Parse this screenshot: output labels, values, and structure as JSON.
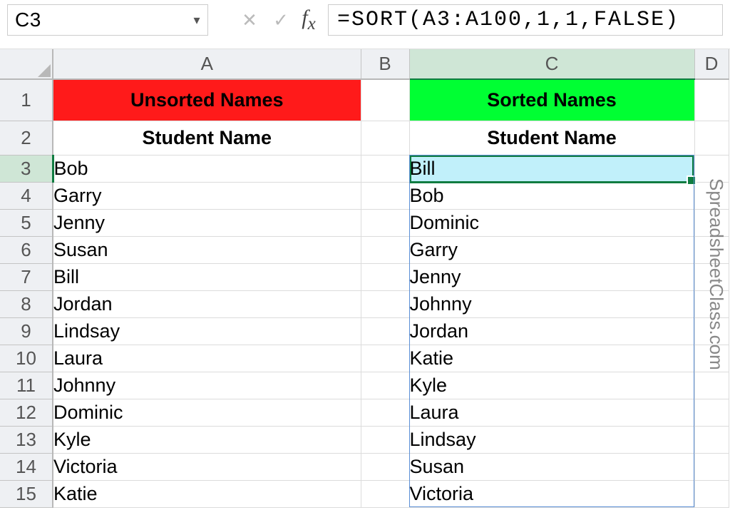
{
  "nameBox": "C3",
  "formula": "=SORT(A3:A100,1,1,FALSE)",
  "columns": [
    "A",
    "B",
    "C",
    "D"
  ],
  "rowNumbers": [
    "1",
    "2",
    "3",
    "4",
    "5",
    "6",
    "7",
    "8",
    "9",
    "10",
    "11",
    "12",
    "13",
    "14",
    "15"
  ],
  "headers": {
    "unsorted": "Unsorted Names",
    "sorted": "Sorted Names",
    "sub": "Student Name"
  },
  "unsorted": [
    "Bob",
    "Garry",
    "Jenny",
    "Susan",
    "Bill",
    "Jordan",
    "Lindsay",
    "Laura",
    "Johnny",
    "Dominic",
    "Kyle",
    "Victoria",
    "Katie"
  ],
  "sorted": [
    "Bill",
    "Bob",
    "Dominic",
    "Garry",
    "Jenny",
    "Johnny",
    "Jordan",
    "Katie",
    "Kyle",
    "Laura",
    "Lindsay",
    "Susan",
    "Victoria"
  ],
  "watermark": "SpreadsheetClass.com"
}
